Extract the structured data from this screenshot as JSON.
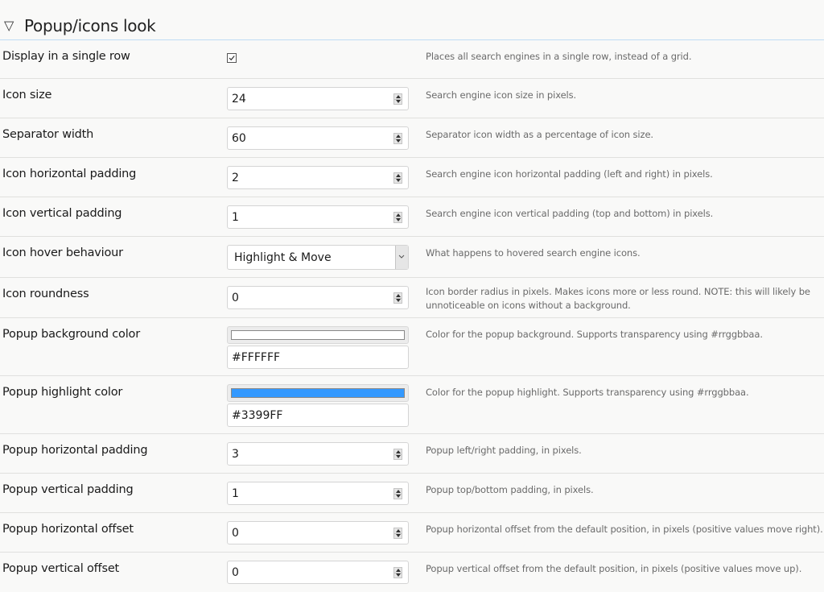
{
  "section": {
    "title": "Popup/icons look",
    "collapse_icon": "triangle-down-icon"
  },
  "settings": [
    {
      "label": "Display in a single row",
      "type": "checkbox",
      "checked": true,
      "description": "Places all search engines in a single row, instead of a grid."
    },
    {
      "label": "Icon size",
      "type": "number",
      "value": "24",
      "description": "Search engine icon size in pixels."
    },
    {
      "label": "Separator width",
      "type": "number",
      "value": "60",
      "description": "Separator icon width as a percentage of icon size."
    },
    {
      "label": "Icon horizontal padding",
      "type": "number",
      "value": "2",
      "description": "Search engine icon horizontal padding (left and right) in pixels."
    },
    {
      "label": "Icon vertical padding",
      "type": "number",
      "value": "1",
      "description": "Search engine icon vertical padding (top and bottom) in pixels."
    },
    {
      "label": "Icon hover behaviour",
      "type": "select",
      "value": "Highlight & Move",
      "description": "What happens to hovered search engine icons."
    },
    {
      "label": "Icon roundness",
      "type": "number",
      "value": "0",
      "description": "Icon border radius in pixels. Makes icons more or less round. NOTE: this will likely be unnoticeable on icons without a background."
    },
    {
      "label": "Popup background color",
      "type": "color",
      "value": "#FFFFFF",
      "swatch": "#FFFFFF",
      "description": "Color for the popup background. Supports transparency using #rrggbbaa."
    },
    {
      "label": "Popup highlight color",
      "type": "color",
      "value": "#3399FF",
      "swatch": "#3399FF",
      "description": "Color for the popup highlight. Supports transparency using #rrggbbaa."
    },
    {
      "label": "Popup horizontal padding",
      "type": "number",
      "value": "3",
      "description": "Popup left/right padding, in pixels."
    },
    {
      "label": "Popup vertical padding",
      "type": "number",
      "value": "1",
      "description": "Popup top/bottom padding, in pixels."
    },
    {
      "label": "Popup horizontal offset",
      "type": "number",
      "value": "0",
      "description": "Popup horizontal offset from the default position, in pixels (positive values move right)."
    },
    {
      "label": "Popup vertical offset",
      "type": "number",
      "value": "0",
      "description": "Popup vertical offset from the default position, in pixels (positive values move up)."
    }
  ]
}
